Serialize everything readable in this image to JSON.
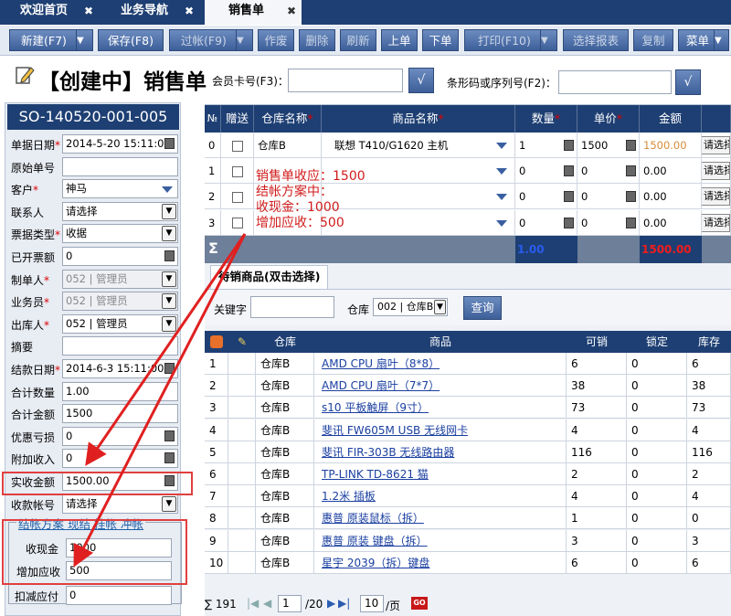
{
  "tabs": [
    {
      "label": "欢迎首页"
    },
    {
      "label": "业务导航"
    },
    {
      "label": "销售单"
    }
  ],
  "tab_close": "✖",
  "toolbar": {
    "new": "新建(F7)",
    "save": "保存(F8)",
    "void": "过帐(F9)",
    "discard": "作废",
    "delete": "删除",
    "refresh": "刷新",
    "prev": "上单",
    "next": "下单",
    "print": "打印(F10)",
    "select_report": "选择报表",
    "copy": "复制",
    "menu": "菜单",
    "dropdown": "▼"
  },
  "header": {
    "title": "【创建中】销售单",
    "member_label": "会员卡号(F3)：",
    "barcode_label": "条形码或序列号(F2)：",
    "ok": "√"
  },
  "form": {
    "so_number": "SO-140520-001-005",
    "fields": [
      {
        "label": "单据日期",
        "req": "*",
        "value": "2014-5-20 15:11:00"
      },
      {
        "label": "原始单号",
        "req": "",
        "value": ""
      },
      {
        "label": "客户",
        "req": "*",
        "value": "神马"
      },
      {
        "label": "联系人",
        "req": "",
        "value": "请选择"
      },
      {
        "label": "票据类型",
        "req": "*",
        "value": "收据"
      },
      {
        "label": "已开票额",
        "req": "",
        "value": "0"
      },
      {
        "label": "制单人",
        "req": "*",
        "value": "052 | 管理员"
      },
      {
        "label": "业务员",
        "req": "*",
        "value": "052 | 管理员"
      },
      {
        "label": "出库人",
        "req": "*",
        "value": "052 | 管理员"
      },
      {
        "label": "摘要",
        "req": "",
        "value": ""
      },
      {
        "label": "结款日期",
        "req": "*",
        "value": "2014-6-3 15:11:00"
      },
      {
        "label": "合计数量",
        "req": "",
        "value": "1.00"
      },
      {
        "label": "合计金额",
        "req": "",
        "value": "1500"
      },
      {
        "label": "优惠亏损",
        "req": "",
        "value": "0"
      },
      {
        "label": "附加收入",
        "req": "",
        "value": "0"
      },
      {
        "label": "实收金额",
        "req": "",
        "value": "1500.00"
      },
      {
        "label": "收款帐号",
        "req": "",
        "value": "请选择"
      }
    ],
    "settle_tabs": [
      "结帐方案",
      "现结",
      "挂帐",
      "冲帐"
    ],
    "settle_fields": [
      {
        "label": "收现金",
        "value": "1000"
      },
      {
        "label": "增加应收",
        "value": "500"
      }
    ],
    "deduct_label": "扣减应付",
    "deduct_value": "0"
  },
  "grid": {
    "headers": [
      "№",
      "赠送",
      "仓库名称",
      "商品名称",
      "数量",
      "单价",
      "金额",
      ""
    ],
    "req": "*",
    "rows": [
      {
        "no": "0",
        "warehouse": "仓库B",
        "product": "联想 T410/G1620 主机",
        "qty": "1",
        "price": "1500",
        "amount": "1500.00",
        "sel": "请选择"
      },
      {
        "no": "1",
        "warehouse": "",
        "product": "",
        "qty": "0",
        "price": "0",
        "amount": "0.00",
        "sel": "请选择"
      },
      {
        "no": "2",
        "warehouse": "",
        "product": "",
        "qty": "0",
        "price": "0",
        "amount": "0.00",
        "sel": "请选择"
      },
      {
        "no": "3",
        "warehouse": "",
        "product": "",
        "qty": "0",
        "price": "0",
        "amount": "0.00",
        "sel": "请选择"
      }
    ],
    "sum_symbol": "Σ",
    "sum_qty": "1.00",
    "sum_amount": "1500.00",
    "colors": {
      "header": "#1e3f73",
      "sum_qty": "#1a3fd0",
      "sum_amount": "#e01010",
      "amount_orange": "#d98c3a"
    }
  },
  "annotation": [
    "销售单收应：1500",
    "结帐方案中：",
    "收现金：1000",
    "增加应收：500"
  ],
  "pending": {
    "tab": "待销商品(双击选择)",
    "keyword_label": "关键字",
    "warehouse_label": "仓库",
    "warehouse_value": "002 | 仓库B",
    "query": "查询",
    "headers": [
      "",
      "",
      "仓库",
      "商品",
      "可销",
      "锁定",
      "库存"
    ],
    "rows": [
      {
        "no": "1",
        "wh": "仓库B",
        "name": "AMD CPU 扇叶（8*8）",
        "avail": "6",
        "lock": "0",
        "stock": "6"
      },
      {
        "no": "2",
        "wh": "仓库B",
        "name": "AMD CPU 扇叶（7*7）",
        "avail": "38",
        "lock": "0",
        "stock": "38"
      },
      {
        "no": "3",
        "wh": "仓库B",
        "name": "s10 平板触屏（9寸）",
        "avail": "73",
        "lock": "0",
        "stock": "73"
      },
      {
        "no": "4",
        "wh": "仓库B",
        "name": "斐讯 FW605M USB 无线网卡",
        "avail": "4",
        "lock": "0",
        "stock": "4"
      },
      {
        "no": "5",
        "wh": "仓库B",
        "name": "斐讯 FIR-303B 无线路由器",
        "avail": "116",
        "lock": "0",
        "stock": "116"
      },
      {
        "no": "6",
        "wh": "仓库B",
        "name": "TP-LINK TD-8621 猫",
        "avail": "2",
        "lock": "0",
        "stock": "2"
      },
      {
        "no": "7",
        "wh": "仓库B",
        "name": "1.2米 插板",
        "avail": "4",
        "lock": "0",
        "stock": "4"
      },
      {
        "no": "8",
        "wh": "仓库B",
        "name": "惠普 原装鼠标（拆）",
        "avail": "1",
        "lock": "0",
        "stock": "0"
      },
      {
        "no": "9",
        "wh": "仓库B",
        "name": "惠普 原装 键盘（拆）",
        "avail": "3",
        "lock": "0",
        "stock": "3"
      },
      {
        "no": "10",
        "wh": "仓库B",
        "name": "星宇 2039（拆）键盘",
        "avail": "6",
        "lock": "0",
        "stock": "6"
      }
    ]
  },
  "pager": {
    "total": "∑ 191",
    "page": "1",
    "pages": "/20",
    "size": "10",
    "unit": "/页",
    "go": "GO"
  }
}
